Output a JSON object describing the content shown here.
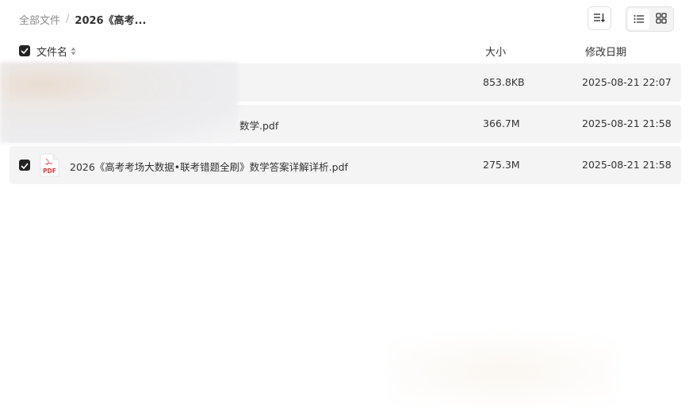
{
  "breadcrumb": {
    "root": "全部文件",
    "separator": "/",
    "current": "2026《高考..."
  },
  "toolbar": {
    "sort_icon": "sort-icon",
    "list_view_icon": "list-view-icon",
    "grid_view_icon": "grid-view-icon",
    "active_view": "list"
  },
  "table": {
    "columns": {
      "name": "文件名",
      "size": "大小",
      "date": "修改日期"
    },
    "header_checked": true,
    "rows": [
      {
        "name": "",
        "size": "853.8KB",
        "date": "2025-08-21 22:07",
        "checked": false
      },
      {
        "name": "数学.pdf",
        "size": "366.7M",
        "date": "2025-08-21 21:58",
        "checked": false
      },
      {
        "name": "2026《高考考场大数据•联考错题全刷》数学答案详解详析.pdf",
        "size": "275.3M",
        "date": "2025-08-21 21:58",
        "checked": true,
        "icon": "pdf-file-icon",
        "icon_label": "PDF"
      }
    ]
  },
  "colors": {
    "row_background": "#f4f4f5",
    "checkbox": "#222222",
    "pdf_red": "#e0393e"
  }
}
